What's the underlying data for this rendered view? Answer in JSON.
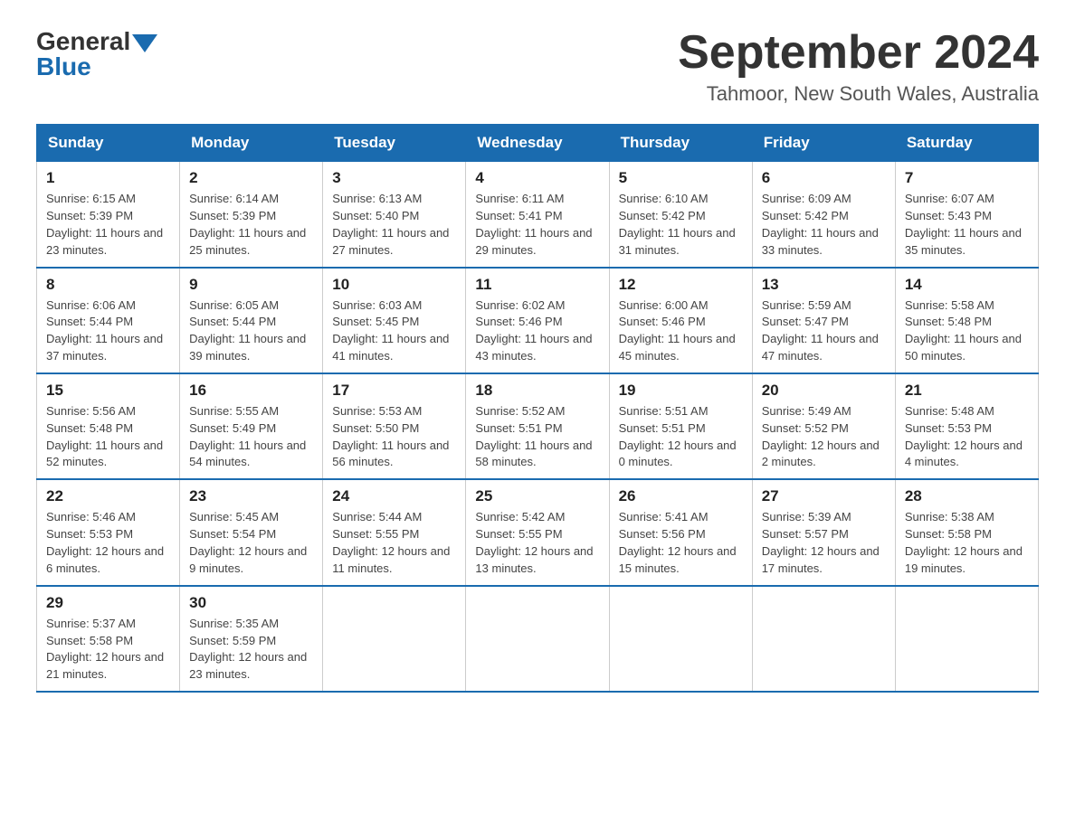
{
  "header": {
    "logo_general": "General",
    "logo_blue": "Blue",
    "month_title": "September 2024",
    "location": "Tahmoor, New South Wales, Australia"
  },
  "days_of_week": [
    "Sunday",
    "Monday",
    "Tuesday",
    "Wednesday",
    "Thursday",
    "Friday",
    "Saturday"
  ],
  "weeks": [
    [
      {
        "num": "1",
        "sunrise": "6:15 AM",
        "sunset": "5:39 PM",
        "daylight": "11 hours and 23 minutes."
      },
      {
        "num": "2",
        "sunrise": "6:14 AM",
        "sunset": "5:39 PM",
        "daylight": "11 hours and 25 minutes."
      },
      {
        "num": "3",
        "sunrise": "6:13 AM",
        "sunset": "5:40 PM",
        "daylight": "11 hours and 27 minutes."
      },
      {
        "num": "4",
        "sunrise": "6:11 AM",
        "sunset": "5:41 PM",
        "daylight": "11 hours and 29 minutes."
      },
      {
        "num": "5",
        "sunrise": "6:10 AM",
        "sunset": "5:42 PM",
        "daylight": "11 hours and 31 minutes."
      },
      {
        "num": "6",
        "sunrise": "6:09 AM",
        "sunset": "5:42 PM",
        "daylight": "11 hours and 33 minutes."
      },
      {
        "num": "7",
        "sunrise": "6:07 AM",
        "sunset": "5:43 PM",
        "daylight": "11 hours and 35 minutes."
      }
    ],
    [
      {
        "num": "8",
        "sunrise": "6:06 AM",
        "sunset": "5:44 PM",
        "daylight": "11 hours and 37 minutes."
      },
      {
        "num": "9",
        "sunrise": "6:05 AM",
        "sunset": "5:44 PM",
        "daylight": "11 hours and 39 minutes."
      },
      {
        "num": "10",
        "sunrise": "6:03 AM",
        "sunset": "5:45 PM",
        "daylight": "11 hours and 41 minutes."
      },
      {
        "num": "11",
        "sunrise": "6:02 AM",
        "sunset": "5:46 PM",
        "daylight": "11 hours and 43 minutes."
      },
      {
        "num": "12",
        "sunrise": "6:00 AM",
        "sunset": "5:46 PM",
        "daylight": "11 hours and 45 minutes."
      },
      {
        "num": "13",
        "sunrise": "5:59 AM",
        "sunset": "5:47 PM",
        "daylight": "11 hours and 47 minutes."
      },
      {
        "num": "14",
        "sunrise": "5:58 AM",
        "sunset": "5:48 PM",
        "daylight": "11 hours and 50 minutes."
      }
    ],
    [
      {
        "num": "15",
        "sunrise": "5:56 AM",
        "sunset": "5:48 PM",
        "daylight": "11 hours and 52 minutes."
      },
      {
        "num": "16",
        "sunrise": "5:55 AM",
        "sunset": "5:49 PM",
        "daylight": "11 hours and 54 minutes."
      },
      {
        "num": "17",
        "sunrise": "5:53 AM",
        "sunset": "5:50 PM",
        "daylight": "11 hours and 56 minutes."
      },
      {
        "num": "18",
        "sunrise": "5:52 AM",
        "sunset": "5:51 PM",
        "daylight": "11 hours and 58 minutes."
      },
      {
        "num": "19",
        "sunrise": "5:51 AM",
        "sunset": "5:51 PM",
        "daylight": "12 hours and 0 minutes."
      },
      {
        "num": "20",
        "sunrise": "5:49 AM",
        "sunset": "5:52 PM",
        "daylight": "12 hours and 2 minutes."
      },
      {
        "num": "21",
        "sunrise": "5:48 AM",
        "sunset": "5:53 PM",
        "daylight": "12 hours and 4 minutes."
      }
    ],
    [
      {
        "num": "22",
        "sunrise": "5:46 AM",
        "sunset": "5:53 PM",
        "daylight": "12 hours and 6 minutes."
      },
      {
        "num": "23",
        "sunrise": "5:45 AM",
        "sunset": "5:54 PM",
        "daylight": "12 hours and 9 minutes."
      },
      {
        "num": "24",
        "sunrise": "5:44 AM",
        "sunset": "5:55 PM",
        "daylight": "12 hours and 11 minutes."
      },
      {
        "num": "25",
        "sunrise": "5:42 AM",
        "sunset": "5:55 PM",
        "daylight": "12 hours and 13 minutes."
      },
      {
        "num": "26",
        "sunrise": "5:41 AM",
        "sunset": "5:56 PM",
        "daylight": "12 hours and 15 minutes."
      },
      {
        "num": "27",
        "sunrise": "5:39 AM",
        "sunset": "5:57 PM",
        "daylight": "12 hours and 17 minutes."
      },
      {
        "num": "28",
        "sunrise": "5:38 AM",
        "sunset": "5:58 PM",
        "daylight": "12 hours and 19 minutes."
      }
    ],
    [
      {
        "num": "29",
        "sunrise": "5:37 AM",
        "sunset": "5:58 PM",
        "daylight": "12 hours and 21 minutes."
      },
      {
        "num": "30",
        "sunrise": "5:35 AM",
        "sunset": "5:59 PM",
        "daylight": "12 hours and 23 minutes."
      },
      null,
      null,
      null,
      null,
      null
    ]
  ],
  "labels": {
    "sunrise_prefix": "Sunrise: ",
    "sunset_prefix": "Sunset: ",
    "daylight_prefix": "Daylight: "
  }
}
